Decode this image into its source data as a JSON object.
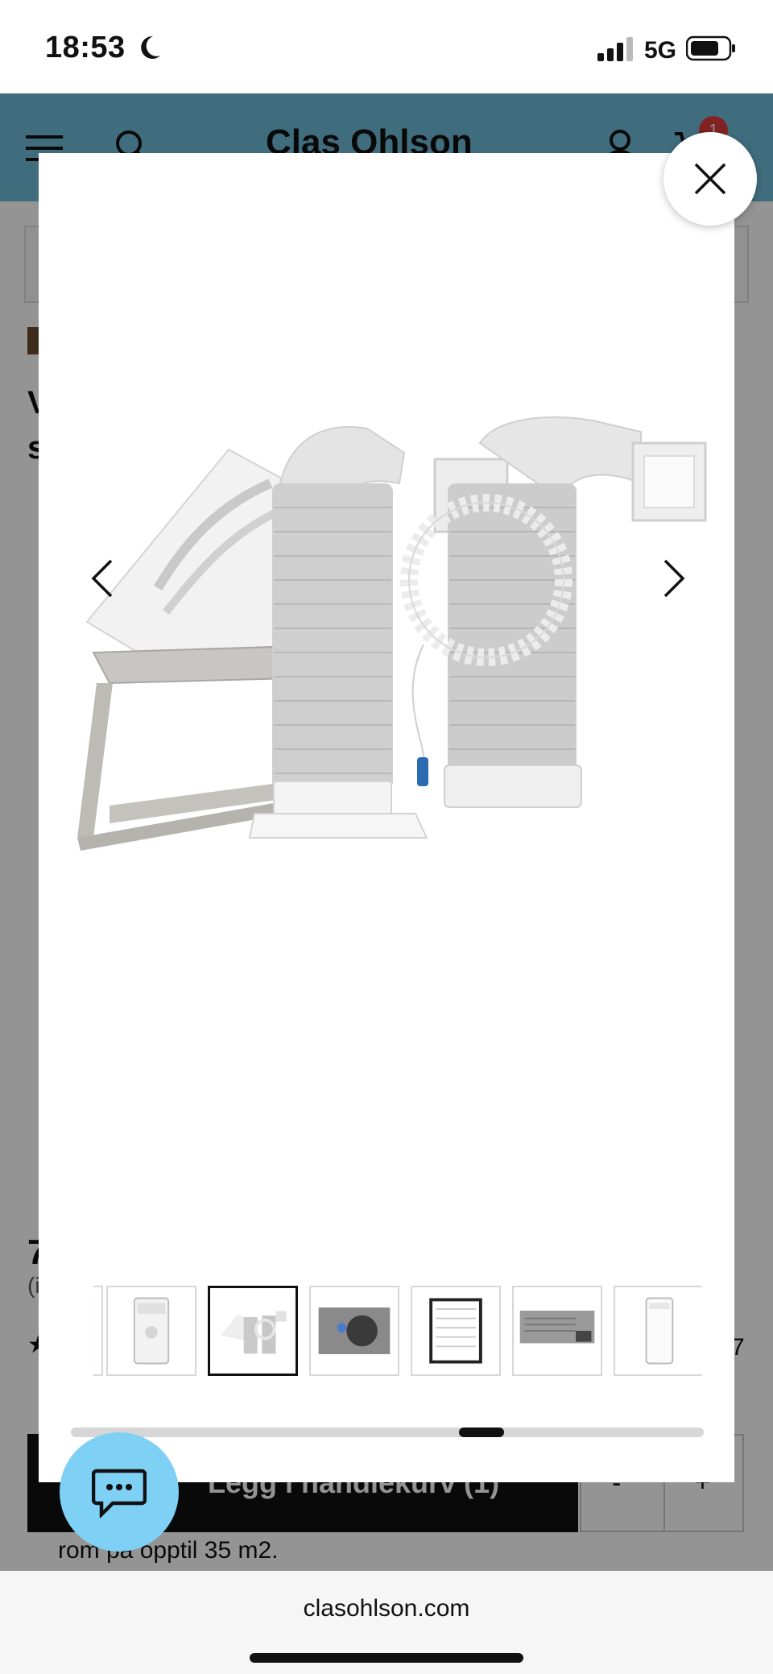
{
  "status_bar": {
    "time": "18:53",
    "network": "5G"
  },
  "site": {
    "logo": "Clas Ohlson",
    "cart_count": "1",
    "title_fragment": "V\ns",
    "price_fragment": "7",
    "incl_fragment": "(i",
    "rating_star": "★",
    "review_fragment": "7",
    "add_to_cart_label": "Legg i handlekurv (1)",
    "qty_minus": "-",
    "qty_plus": "+",
    "description_fragment": "rom på opptil 35 m2."
  },
  "gallery": {
    "close_icon": "close-icon",
    "prev_icon": "chevron-left-icon",
    "next_icon": "chevron-right-icon",
    "thumbnails_count": 7,
    "active_thumbnail": 2,
    "scroll_position": 0.66
  },
  "chat": {
    "icon": "chat-bubble-icon",
    "color": "#7fd0f5"
  },
  "browser": {
    "url": "clasohlson.com"
  }
}
